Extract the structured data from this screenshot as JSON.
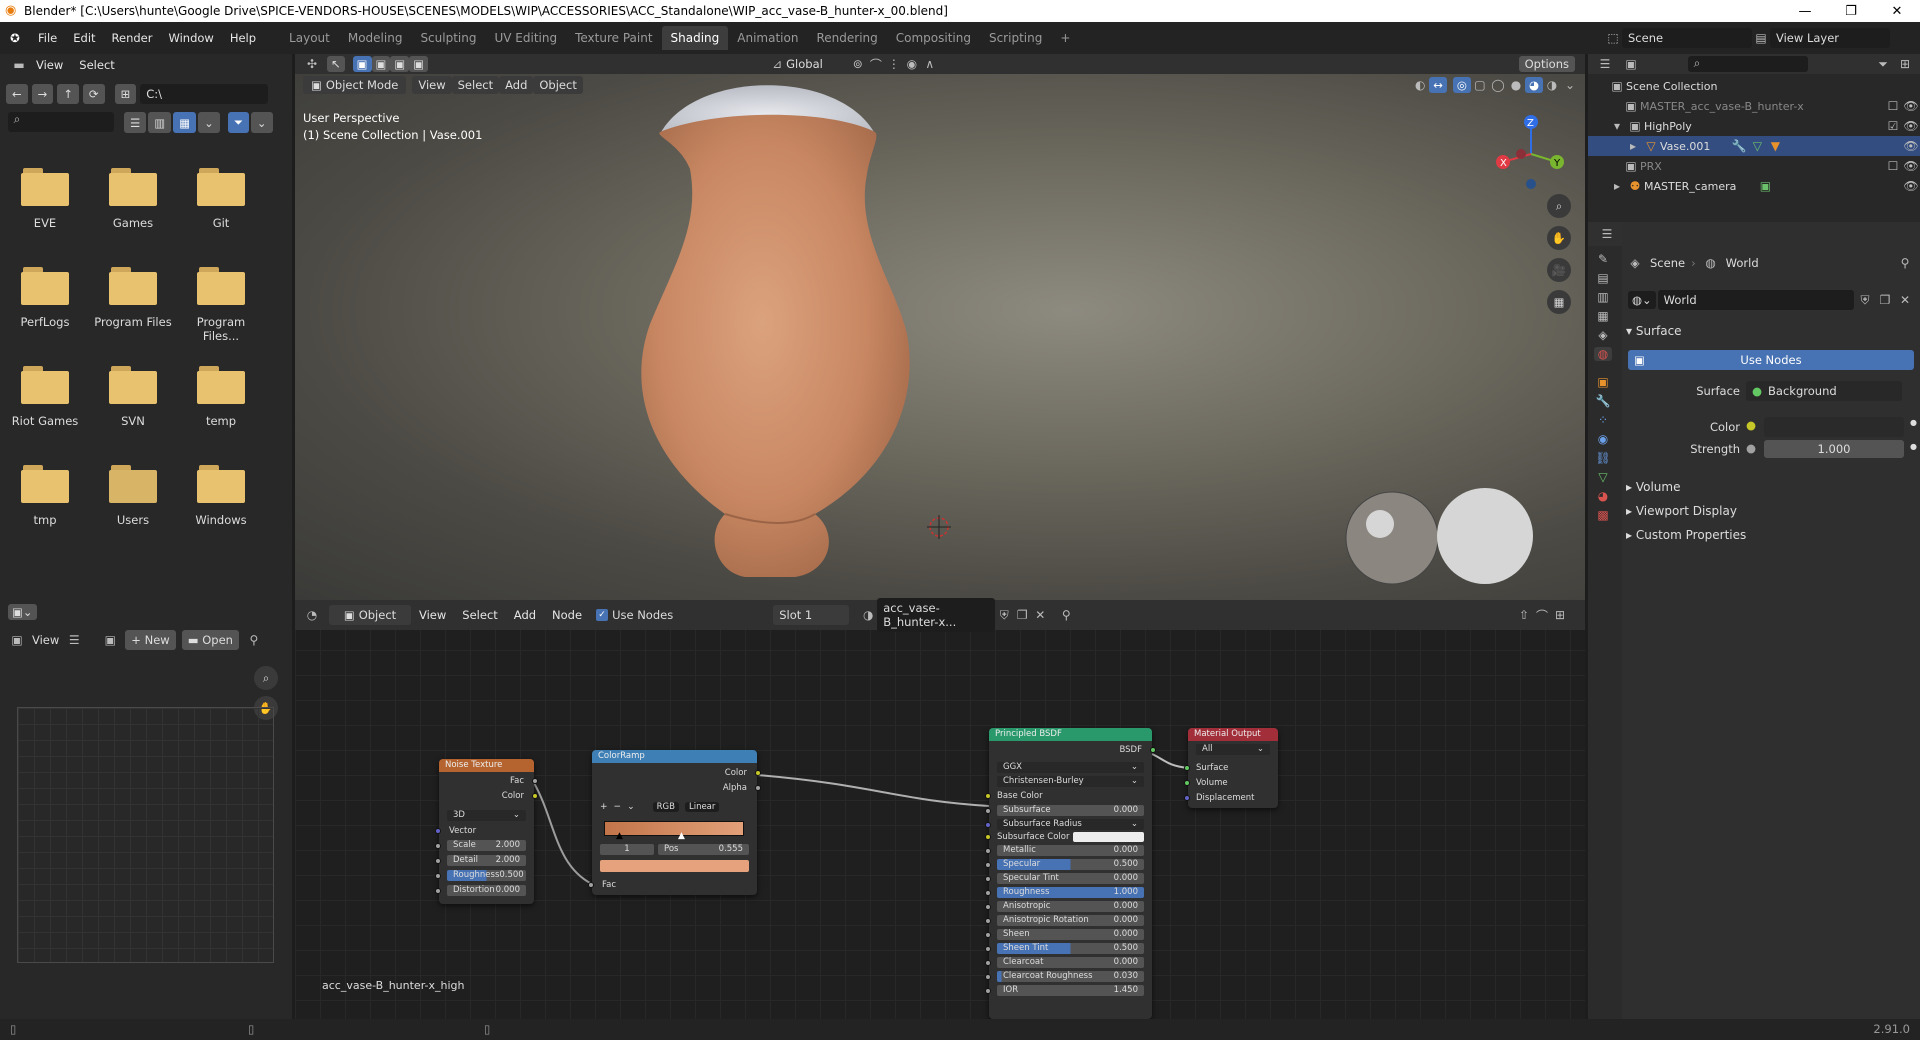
{
  "window": {
    "title": "Blender* [C:\\Users\\hunte\\Google Drive\\SPICE-VENDORS-HOUSE\\SCENES\\MODELS\\WIP\\ACCESSORIES\\ACC_Standalone\\WIP_acc_vase-B_hunter-x_00.blend]"
  },
  "menu": [
    "File",
    "Edit",
    "Render",
    "Window",
    "Help"
  ],
  "workspaces": [
    "Layout",
    "Modeling",
    "Sculpting",
    "UV Editing",
    "Texture Paint",
    "Shading",
    "Animation",
    "Rendering",
    "Compositing",
    "Scripting"
  ],
  "active_workspace": "Shading",
  "scene": "Scene",
  "view_layer": "View Layer",
  "filebrowser": {
    "menu": [
      "View",
      "Select"
    ],
    "path": "C:\\",
    "folders": [
      "EVE",
      "Games",
      "Git",
      "PerfLogs",
      "Program Files",
      "Program Files...",
      "Riot Games",
      "SVN",
      "temp",
      "tmp",
      "Users",
      "Windows"
    ]
  },
  "viewport": {
    "mode": "Object Mode",
    "menu": [
      "View",
      "Select",
      "Add",
      "Object"
    ],
    "transform": "Global",
    "options": "Options",
    "perspective": "User Perspective",
    "collection": "(1) Scene Collection | Vase.001",
    "gizmo": {
      "x": "X",
      "y": "Y",
      "z": "Z"
    }
  },
  "image_editor": {
    "view": "View",
    "new": "New",
    "open": "Open"
  },
  "node_editor": {
    "type": "Object",
    "menu": [
      "View",
      "Select",
      "Add",
      "Node"
    ],
    "use_nodes": "Use Nodes",
    "slot": "Slot 1",
    "material": "acc_vase-B_hunter-x...",
    "footer": "acc_vase-B_hunter-x_high"
  },
  "nodes": {
    "noise": {
      "title": "Noise Texture",
      "out1": "Fac",
      "out2": "Color",
      "dim": "3D",
      "vector": "Vector",
      "rows": [
        {
          "label": "Scale",
          "value": "2.000"
        },
        {
          "label": "Detail",
          "value": "2.000"
        },
        {
          "label": "Roughness",
          "value": "0.500"
        },
        {
          "label": "Distortion",
          "value": "0.000"
        }
      ]
    },
    "ramp": {
      "title": "ColorRamp",
      "out1": "Color",
      "out2": "Alpha",
      "mode": "RGB",
      "interp": "Linear",
      "index": "1",
      "pos_label": "Pos",
      "pos": "0.555",
      "fac": "Fac"
    },
    "bsdf": {
      "title": "Principled BSDF",
      "out": "BSDF",
      "dist": "GGX",
      "sss": "Christensen-Burley",
      "base": "Base Color",
      "sss_color": "Subsurface Color",
      "sss_radius": "Subsurface Radius",
      "rows": [
        {
          "label": "Subsurface",
          "value": "0.000"
        },
        {
          "label": "Metallic",
          "value": "0.000"
        },
        {
          "label": "Specular",
          "value": "0.500"
        },
        {
          "label": "Specular Tint",
          "value": "0.000"
        },
        {
          "label": "Roughness",
          "value": "1.000"
        },
        {
          "label": "Anisotropic",
          "value": "0.000"
        },
        {
          "label": "Anisotropic Rotation",
          "value": "0.000"
        },
        {
          "label": "Sheen",
          "value": "0.000"
        },
        {
          "label": "Sheen Tint",
          "value": "0.500"
        },
        {
          "label": "Clearcoat",
          "value": "0.000"
        },
        {
          "label": "Clearcoat Roughness",
          "value": "0.030"
        },
        {
          "label": "IOR",
          "value": "1.450"
        }
      ]
    },
    "output": {
      "title": "Material Output",
      "target": "All",
      "inputs": [
        "Surface",
        "Volume",
        "Displacement"
      ]
    }
  },
  "outliner": {
    "rows": [
      "Scene Collection",
      "MASTER_acc_vase-B_hunter-x",
      "HighPoly",
      "Vase.001",
      "PRX",
      "MASTER_camera"
    ]
  },
  "properties": {
    "breadcrumb1": "Scene",
    "breadcrumb2": "World",
    "world": "World",
    "surface_section": "Surface",
    "use_nodes": "Use Nodes",
    "surface_label": "Surface",
    "surface_value": "Background",
    "color_label": "Color",
    "strength_label": "Strength",
    "strength_value": "1.000",
    "sections": [
      "Volume",
      "Viewport Display",
      "Custom Properties"
    ]
  },
  "status": {
    "version": "2.91.0"
  }
}
